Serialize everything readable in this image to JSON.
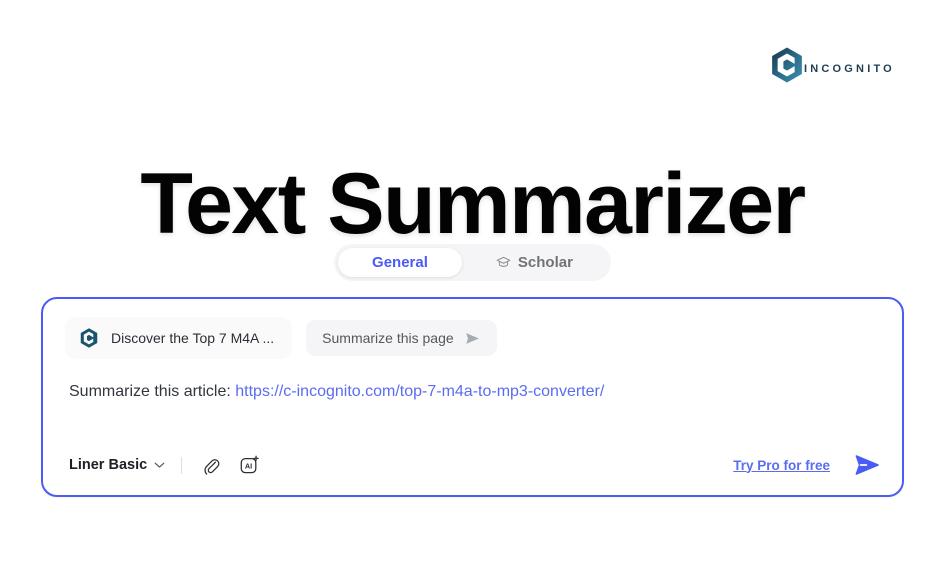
{
  "brand": {
    "wordmark": "INCOGNITO",
    "logo_icon": "incognito-hexagon-c-logo",
    "color_dark": "#1f3d52",
    "color_teal": "#2e7f9e"
  },
  "page": {
    "title": "Text Summarizer",
    "background": "#ffffff",
    "accent": "#4a5cf5"
  },
  "tabs": {
    "items": [
      {
        "label": "General",
        "active": true,
        "icon": ""
      },
      {
        "label": "Scholar",
        "active": false,
        "icon": "graduation-cap-icon"
      }
    ]
  },
  "composer": {
    "border_color": "#4a5cf5",
    "source_chip": {
      "label": "Discover the Top 7 M4A ...",
      "favicon": "incognito-c-favicon"
    },
    "page_action": {
      "label": "Summarize this page",
      "icon": "send-arrow-icon"
    },
    "prompt": {
      "text": "Summarize this article: ",
      "url": "https://c-incognito.com/top-7-m4a-to-mp3-converter/"
    },
    "toolbar": {
      "model_label": "Liner Basic",
      "model_chevron": "chevron-down-icon",
      "attach_icon": "paperclip-icon",
      "ai_icon": "ai-sparkle-icon",
      "try_pro_label": "Try Pro for free",
      "send_icon": "send-arrow-filled-icon"
    }
  }
}
